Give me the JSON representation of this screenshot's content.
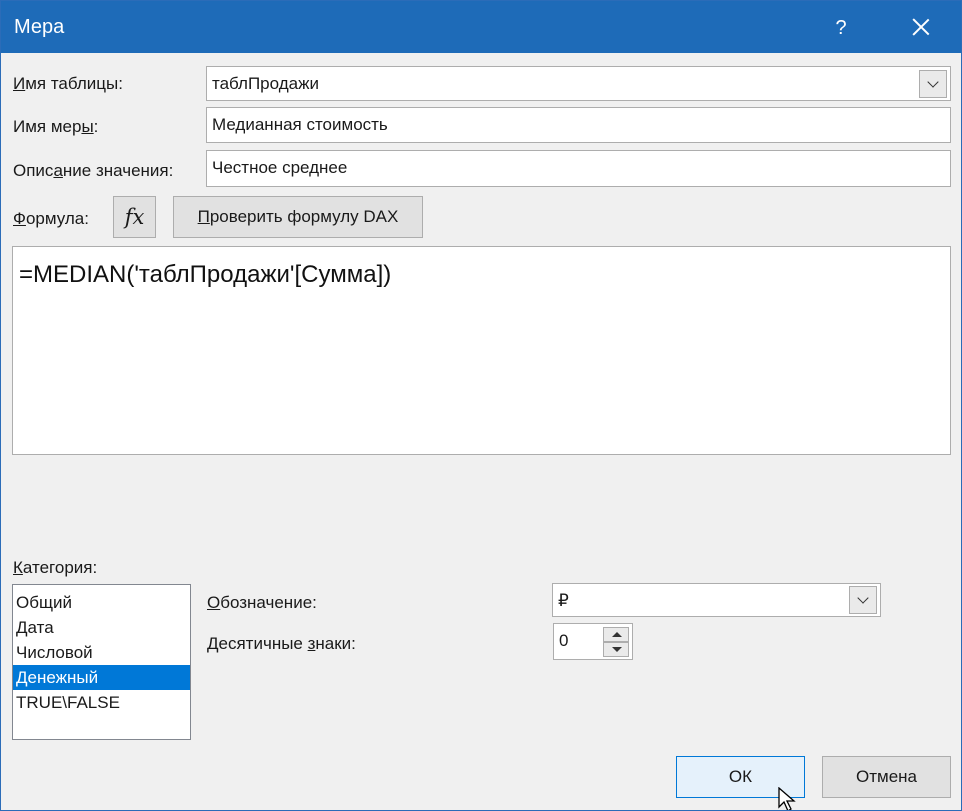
{
  "window": {
    "title": "Мера",
    "help": "?"
  },
  "table_name": {
    "label": "Имя таблицы:",
    "value": "таблПродажи"
  },
  "measure_name": {
    "label": "Имя меры:",
    "value": "Медианная стоимость"
  },
  "description": {
    "label": "Описание значения:",
    "value": "Честное среднее"
  },
  "formula": {
    "label": "Формула:",
    "fx_label": "fx",
    "check_button": "Проверить формулу DAX",
    "text": "=MEDIAN('таблПродажи'[Сумма])"
  },
  "category": {
    "label": "Категория:",
    "items": [
      "Общий",
      "Дата",
      "Числовой",
      "Денежный",
      "TRUE\\FALSE"
    ],
    "selected": "Денежный"
  },
  "symbol": {
    "label": "Обозначение:",
    "value": "₽"
  },
  "decimals": {
    "label": "Десятичные знаки:",
    "value": "0"
  },
  "buttons": {
    "ok": "ОК",
    "cancel": "Отмена"
  },
  "colors": {
    "titlebar": "#1e6bb8",
    "selection": "#0078d7",
    "ok_border": "#0078d7"
  }
}
